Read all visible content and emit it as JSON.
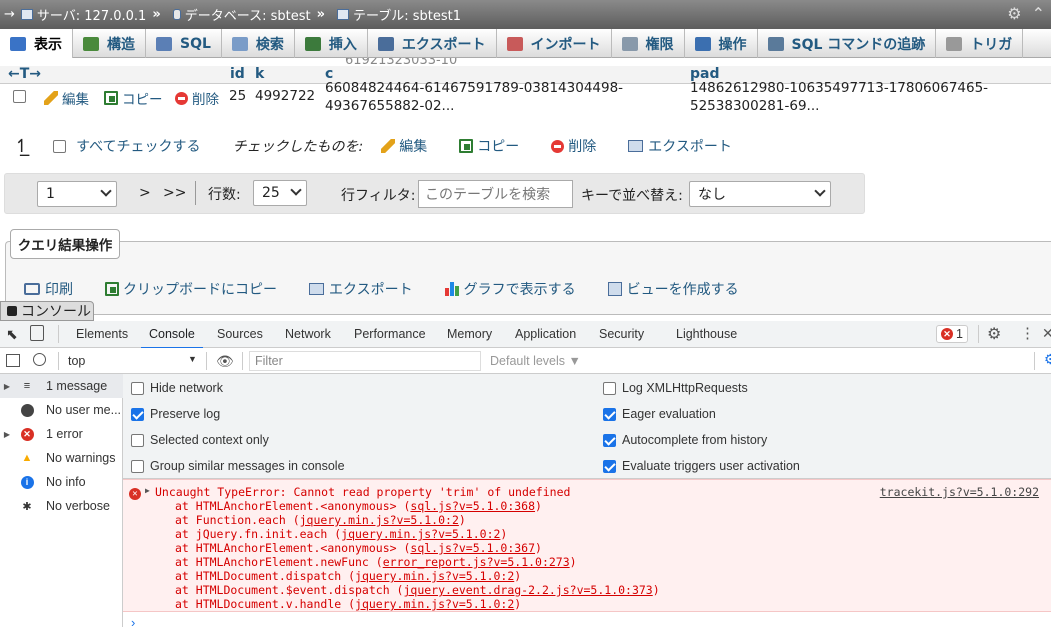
{
  "breadcrumb": {
    "back": "→",
    "server": "サーバ: 127.0.0.1",
    "database": "データベース: sbtest",
    "table": "テーブル: sbtest1",
    "sep": "»"
  },
  "tabs": [
    {
      "label": "表示",
      "active": true,
      "color": "#3a73c6"
    },
    {
      "label": "構造",
      "active": false,
      "color": "#4a8a3c"
    },
    {
      "label": "SQL",
      "active": false,
      "color": "#5b7fb5"
    },
    {
      "label": "検索",
      "active": false,
      "color": "#7a9cc8"
    },
    {
      "label": "挿入",
      "active": false,
      "color": "#3c7a3c"
    },
    {
      "label": "エクスポート",
      "active": false,
      "color": "#4a6d9a"
    },
    {
      "label": "インポート",
      "active": false,
      "color": "#c85a5a"
    },
    {
      "label": "権限",
      "active": false,
      "color": "#8899aa"
    },
    {
      "label": "操作",
      "active": false,
      "color": "#3b6fb0"
    },
    {
      "label": "SQL コマンドの追跡",
      "active": false,
      "color": "#5a7a9a"
    },
    {
      "label": "トリガ",
      "active": false,
      "color": "#999999"
    }
  ],
  "table": {
    "sort_arrows": "←T→",
    "columns": {
      "id": "id",
      "k": "k",
      "c": "c",
      "pad": "pad"
    },
    "ghost_text": "61921323033-10",
    "row": {
      "edit": "編集",
      "copy": "コピー",
      "delete": "削除",
      "id": "25",
      "k": "4992722",
      "c_line1": "66084824464-61467591789-03814304498-",
      "c_line2": "49367655882-02...",
      "pad_line1": "14862612980-10635497713-17806067465-",
      "pad_line2": "52538300281-69..."
    }
  },
  "checkall": {
    "label": "すべてチェックする",
    "with_selected": "チェックしたものを:",
    "edit": "編集",
    "copy": "コピー",
    "delete": "削除",
    "export": "エクスポート"
  },
  "nav": {
    "page": "1",
    "next": ">",
    "last": ">>",
    "rows_label": "行数:",
    "rows_value": "25",
    "filter_label": "行フィルタ:",
    "filter_placeholder": "このテーブルを検索",
    "sort_label": "キーで並べ替え:",
    "sort_value": "なし"
  },
  "query_ops": {
    "title": "クエリ結果操作",
    "print": "印刷",
    "clipboard": "クリップボードにコピー",
    "export": "エクスポート",
    "chart": "グラフで表示する",
    "view": "ビューを作成する"
  },
  "console_pill": "コンソール",
  "devtools": {
    "tabs": [
      "Elements",
      "Console",
      "Sources",
      "Network",
      "Performance",
      "Memory",
      "Application",
      "Security",
      "Lighthouse"
    ],
    "active_tab": "Console",
    "error_count": "1",
    "context": "top",
    "filter_placeholder": "Filter",
    "levels": "Default levels ▼",
    "sidebar": [
      {
        "label": "1 message",
        "icon": "list-icon",
        "expandable": true
      },
      {
        "label": "No user me...",
        "icon": "user-icon",
        "expandable": false
      },
      {
        "label": "1 error",
        "icon": "error-icon",
        "expandable": true
      },
      {
        "label": "No warnings",
        "icon": "warning-icon",
        "expandable": false
      },
      {
        "label": "No info",
        "icon": "info-icon",
        "expandable": false
      },
      {
        "label": "No verbose",
        "icon": "bug-icon",
        "expandable": false
      }
    ],
    "settings": {
      "hide_network": "Hide network",
      "preserve_log": "Preserve log",
      "selected_context": "Selected context only",
      "group_similar": "Group similar messages in console",
      "log_xhr": "Log XMLHttpRequests",
      "eager_eval": "Eager evaluation",
      "autocomplete": "Autocomplete from history",
      "eval_triggers": "Evaluate triggers user activation"
    },
    "error": {
      "message": "Uncaught TypeError: Cannot read property 'trim' of undefined",
      "source": "tracekit.js?v=5.1.0:292",
      "stack": [
        {
          "prefix": "at HTMLAnchorElement.<anonymous> (",
          "link": "sql.js?v=5.1.0:368",
          "suffix": ")"
        },
        {
          "prefix": "at Function.each (",
          "link": "jquery.min.js?v=5.1.0:2",
          "suffix": ")"
        },
        {
          "prefix": "at jQuery.fn.init.each (",
          "link": "jquery.min.js?v=5.1.0:2",
          "suffix": ")"
        },
        {
          "prefix": "at HTMLAnchorElement.<anonymous> (",
          "link": "sql.js?v=5.1.0:367",
          "suffix": ")"
        },
        {
          "prefix": "at HTMLAnchorElement.newFunc (",
          "link": "error_report.js?v=5.1.0:273",
          "suffix": ")"
        },
        {
          "prefix": "at HTMLDocument.dispatch (",
          "link": "jquery.min.js?v=5.1.0:2",
          "suffix": ")"
        },
        {
          "prefix": "at HTMLDocument.$event.dispatch (",
          "link": "jquery.event.drag-2.2.js?v=5.1.0:373",
          "suffix": ")"
        },
        {
          "prefix": "at HTMLDocument.v.handle (",
          "link": "jquery.min.js?v=5.1.0:2",
          "suffix": ")"
        }
      ]
    },
    "prompt": "›"
  }
}
